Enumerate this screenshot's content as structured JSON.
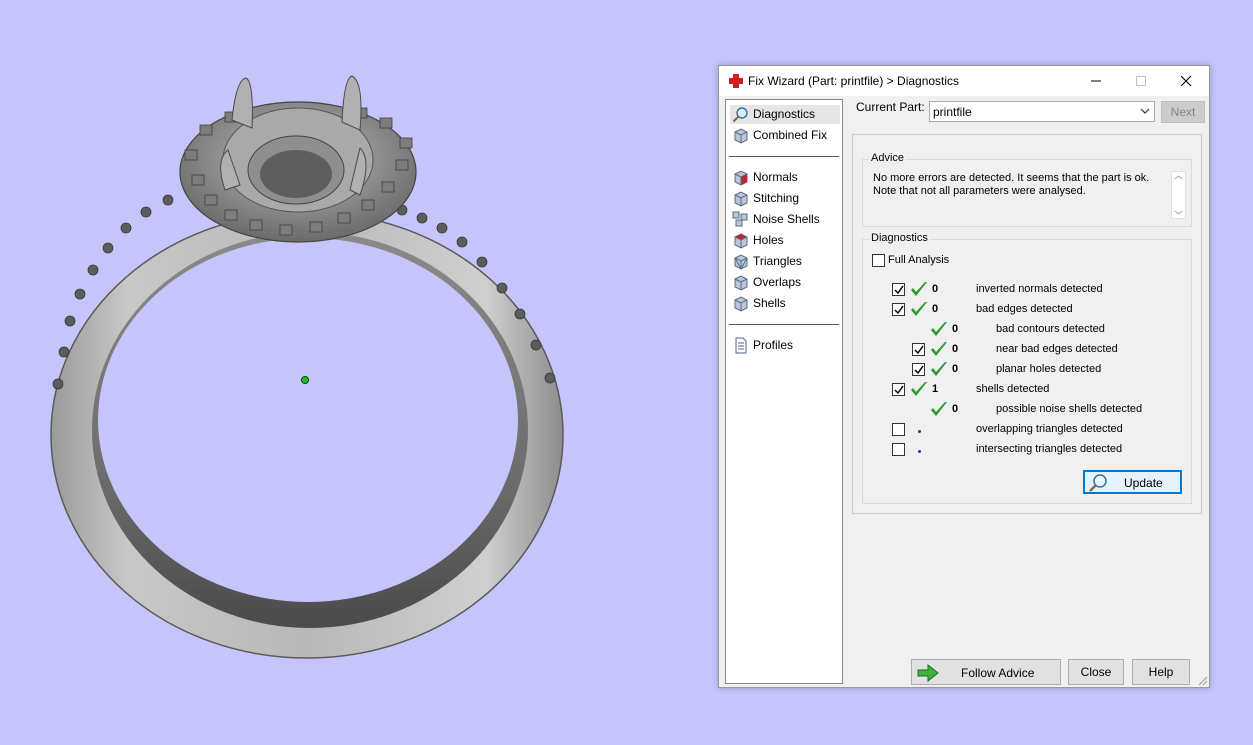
{
  "window": {
    "title": "Fix Wizard (Part: printfile) > Diagnostics"
  },
  "nav": {
    "top": [
      {
        "label": "Diagnostics",
        "icon": "magnifier-icon",
        "selected": true
      },
      {
        "label": "Combined Fix",
        "icon": "cube-icon"
      }
    ],
    "tools": [
      {
        "label": "Normals",
        "icon": "normals-cube-icon"
      },
      {
        "label": "Stitching",
        "icon": "stitching-cube-icon"
      },
      {
        "label": "Noise Shells",
        "icon": "noise-shells-icon"
      },
      {
        "label": "Holes",
        "icon": "holes-cube-icon"
      },
      {
        "label": "Triangles",
        "icon": "triangles-cube-icon"
      },
      {
        "label": "Overlaps",
        "icon": "overlaps-cube-icon"
      },
      {
        "label": "Shells",
        "icon": "shells-cube-icon"
      }
    ],
    "bottom": [
      {
        "label": "Profiles",
        "icon": "document-icon"
      }
    ]
  },
  "current_part": {
    "label": "Current Part:",
    "value": "printfile",
    "next_label": "Next"
  },
  "advice": {
    "label": "Advice",
    "line1": "No more errors are detected. It seems that the part is ok.",
    "line2": "Note that not all parameters were analysed."
  },
  "diagnostics": {
    "label": "Diagnostics",
    "full_analysis_label": "Full Analysis",
    "full_analysis_checked": false,
    "items": [
      {
        "checkbox": true,
        "checked": true,
        "status": "ok",
        "count": "0",
        "label": "inverted normals detected",
        "indent": 0
      },
      {
        "checkbox": true,
        "checked": true,
        "status": "ok",
        "count": "0",
        "label": "bad edges detected",
        "indent": 0
      },
      {
        "checkbox": false,
        "checked": false,
        "status": "ok",
        "count": "0",
        "label": "bad contours detected",
        "indent": 1
      },
      {
        "checkbox": true,
        "checked": true,
        "status": "ok",
        "count": "0",
        "label": "near bad edges detected",
        "indent": 1
      },
      {
        "checkbox": true,
        "checked": true,
        "status": "ok",
        "count": "0",
        "label": "planar holes detected",
        "indent": 1
      },
      {
        "checkbox": true,
        "checked": true,
        "status": "ok",
        "count": "1",
        "label": "shells detected",
        "indent": 0
      },
      {
        "checkbox": false,
        "checked": false,
        "status": "ok",
        "count": "0",
        "label": "possible noise shells detected",
        "indent": 1
      },
      {
        "checkbox": true,
        "checked": false,
        "status": "pending",
        "count": "",
        "label": "overlapping triangles detected",
        "indent": 0
      },
      {
        "checkbox": true,
        "checked": false,
        "status": "pending",
        "count": "",
        "label": "intersecting triangles detected",
        "indent": 0
      }
    ],
    "update_label": "Update"
  },
  "buttons": {
    "follow_advice": "Follow Advice",
    "close": "Close",
    "help": "Help"
  },
  "colors": {
    "viewport_bg": "#c5c5fb",
    "ok_check": "#2e9a2e",
    "accent": "#0078d7"
  }
}
